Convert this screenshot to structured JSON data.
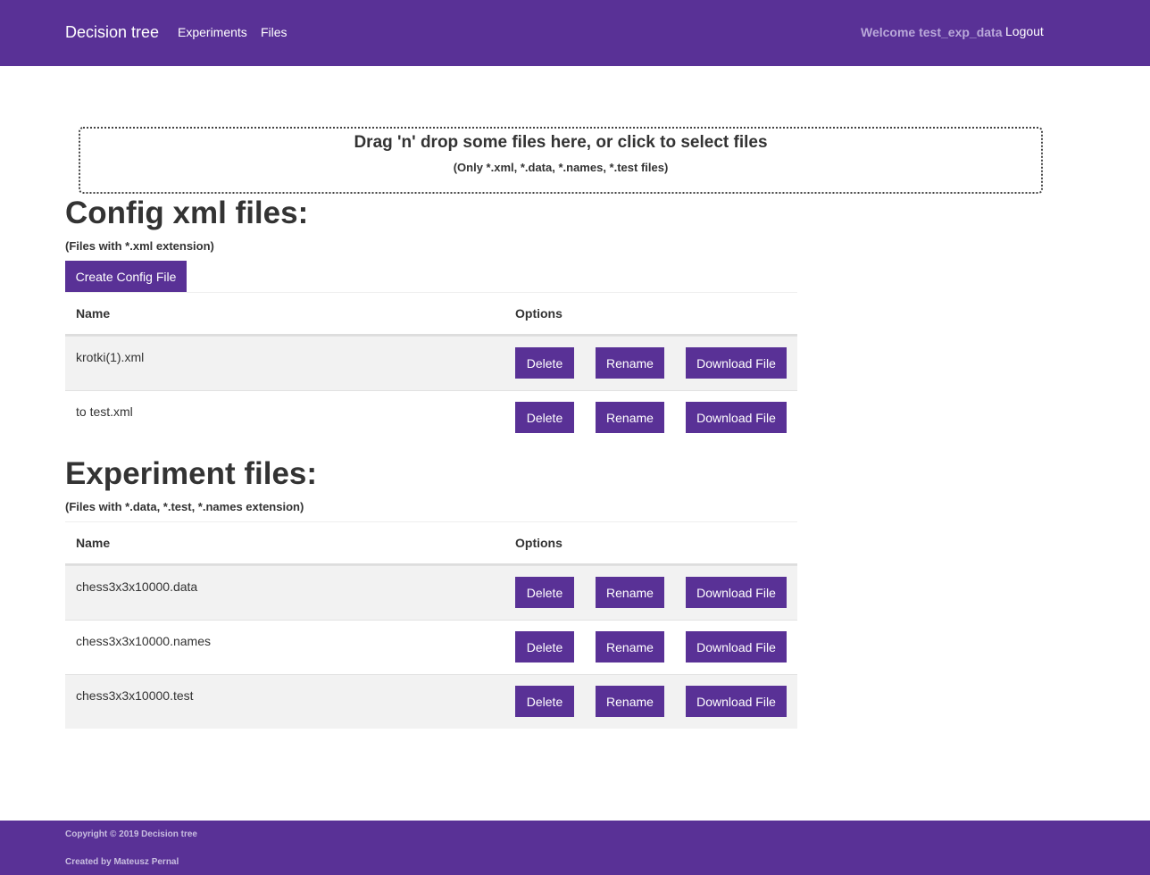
{
  "navbar": {
    "brand": "Decision tree",
    "links": [
      "Experiments",
      "Files"
    ],
    "welcome": "Welcome test_exp_data",
    "logout": "Logout"
  },
  "dropzone": {
    "title": "Drag 'n' drop some files here, or click to select files",
    "subtitle": "(Only *.xml, *.data, *.names, *.test files)"
  },
  "config": {
    "heading": "Config xml files:",
    "subheading": "(Files with *.xml extension)",
    "create_label": "Create Config File",
    "col_name": "Name",
    "col_options": "Options",
    "files": [
      "krotki(1).xml",
      "to test.xml"
    ]
  },
  "experiment": {
    "heading": "Experiment files:",
    "subheading": "(Files with *.data, *.test, *.names extension)",
    "col_name": "Name",
    "col_options": "Options",
    "files": [
      "chess3x3x10000.data",
      "chess3x3x10000.names",
      "chess3x3x10000.test"
    ]
  },
  "actions": {
    "delete": "Delete",
    "rename": "Rename",
    "download": "Download File"
  },
  "footer": {
    "copyright": "Copyright © 2019 Decision tree",
    "created": "Created by Mateusz Pernal"
  },
  "colors": {
    "primary": "#593196",
    "row_stripe": "#f2f2f2"
  }
}
